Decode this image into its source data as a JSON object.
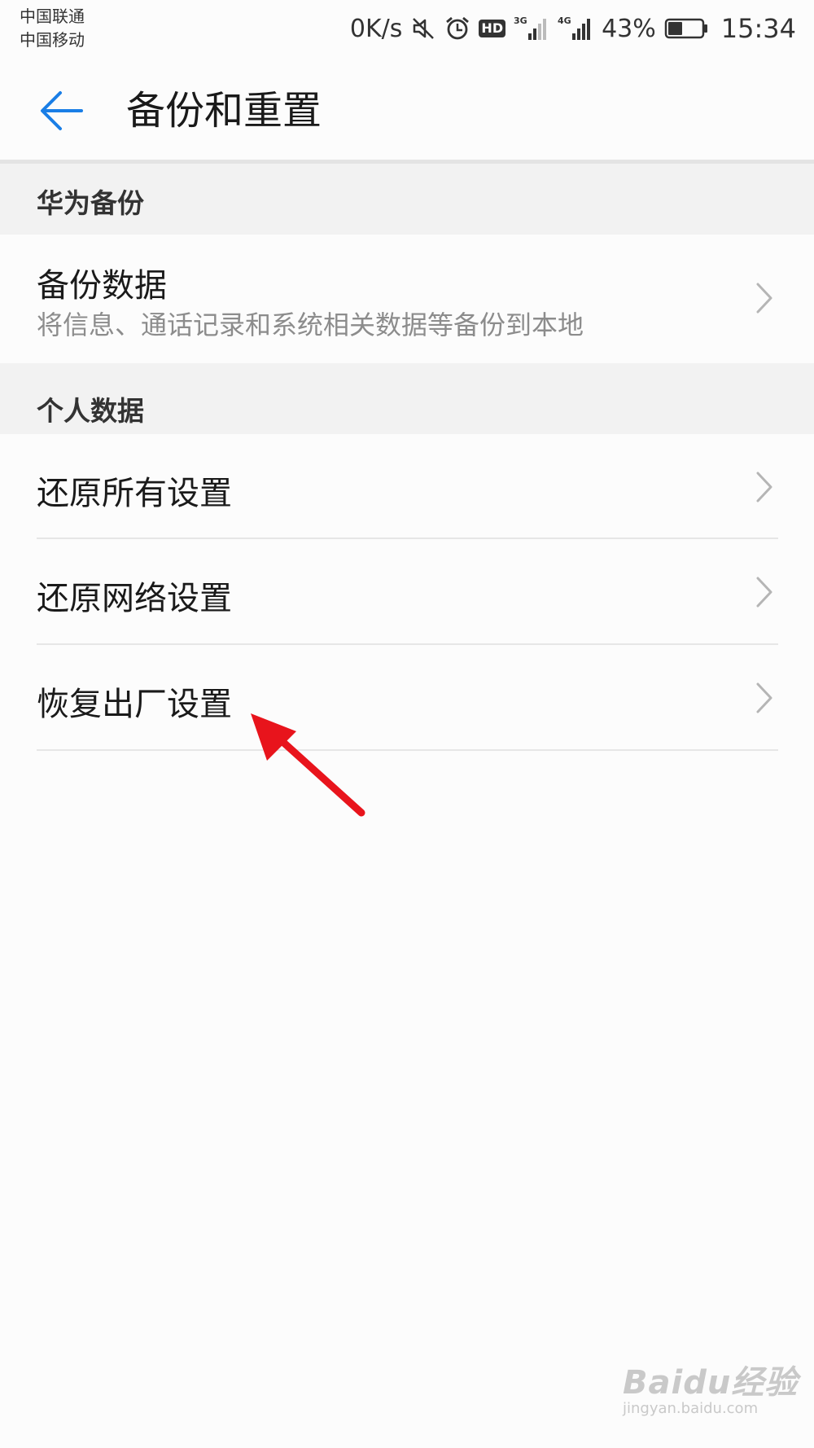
{
  "status_bar": {
    "carrier_1": "中国联通",
    "carrier_2": "中国移动",
    "net_speed": "0K/s",
    "hd_label": "HD",
    "network_1": "3G",
    "network_2": "4G",
    "battery_percent": "43%",
    "battery_level": 0.43,
    "time": "15:34",
    "icons": [
      "mute-icon",
      "alarm-icon",
      "hd-icon",
      "signal-3g-icon",
      "signal-4g-icon",
      "battery-icon"
    ]
  },
  "header": {
    "back_icon": "arrow-left-icon",
    "title": "备份和重置",
    "accent_color": "#1a7ee6"
  },
  "sections": [
    {
      "header": "华为备份",
      "items": [
        {
          "title": "备份数据",
          "subtitle": "将信息、通话记录和系统相关数据等备份到本地"
        }
      ]
    },
    {
      "header": "个人数据",
      "items": [
        {
          "title": "还原所有设置"
        },
        {
          "title": "还原网络设置"
        },
        {
          "title": "恢复出厂设置"
        }
      ]
    }
  ],
  "annotation": {
    "color": "#e8141c",
    "target": "恢复出厂设置"
  },
  "watermark": {
    "logo": "Baidu经验",
    "url": "jingyan.baidu.com"
  }
}
